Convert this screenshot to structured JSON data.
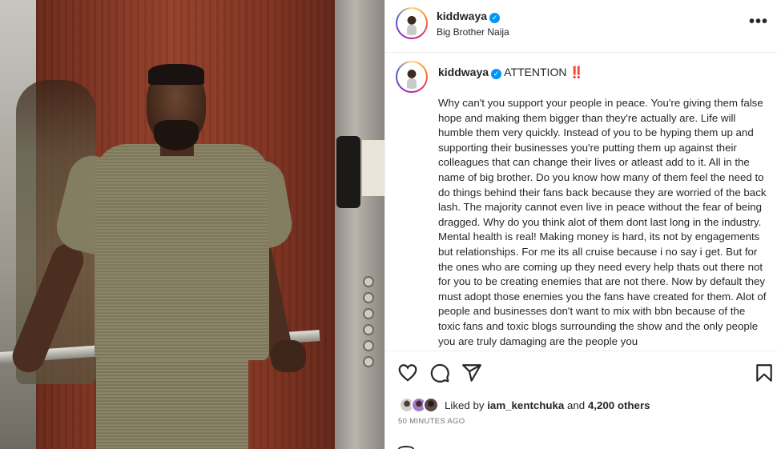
{
  "post": {
    "username": "kiddwaya",
    "verified": true,
    "location": "Big Brother Naija",
    "more_label": "•••",
    "caption_title": "ATTENTION ‼️",
    "caption_body": "Why can't you support your people in peace. You're giving them false hope and making them bigger than they're actually are. Life will humble them very quickly. Instead of you to be hyping them up and supporting their businesses you're putting them up against their colleagues that can change their lives or atleast add to it. All in the name of big brother. Do you know how many of them feel the need to do things behind their fans back because they are worried of the back lash. The majority cannot even live in peace without the fear of being dragged. Why do you think alot of them dont last long in the industry. Mental health is real! Making money is hard, its not by engagements but relationships. For me its all cruise because i no say i get. But for the ones who are coming up they need every help thats out there not for you to be creating enemies that are not there. Now by default they must adopt those enemies you the fans have created for them. Alot of people and businesses don't want to mix with bbn because of the toxic fans and toxic blogs surrounding the show and the only people you are truly damaging are the people you",
    "likes": {
      "prefix": "Liked by",
      "first_liker": "iam_kentchuka",
      "connector": "and",
      "others": "4,200 others"
    },
    "timestamp": "50 MINUTES AGO"
  },
  "icons": {
    "like": "heart-icon",
    "comment": "comment-icon",
    "share": "paper-plane-icon",
    "save": "bookmark-icon",
    "verified": "verified-badge-icon",
    "more": "more-options-icon"
  },
  "colors": {
    "verified_blue": "#0095f6",
    "text": "#262626",
    "muted": "#737373",
    "divider": "#efefef"
  }
}
